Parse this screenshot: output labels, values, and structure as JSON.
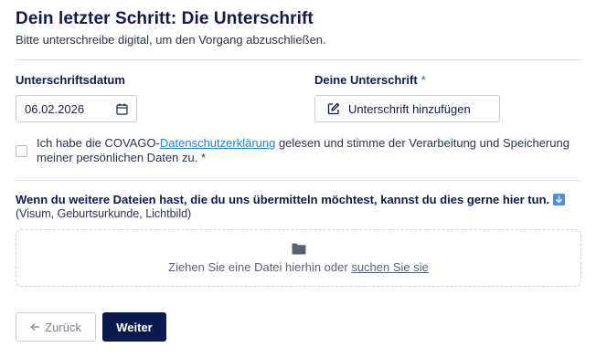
{
  "header": {
    "title": "Dein letzter Schritt: Die Unterschrift",
    "subtitle": "Bitte unterschreibe digital, um den Vorgang abzuschließen."
  },
  "date_field": {
    "label": "Unterschriftsdatum",
    "value": "06.02.2026",
    "icon": "calendar-icon"
  },
  "signature_field": {
    "label": "Deine Unterschrift",
    "required_marker": "*",
    "button_label": "Unterschrift hinzufügen",
    "icon": "edit-icon"
  },
  "consent": {
    "checked": false,
    "text_before": "Ich habe die COVAGO-",
    "link_text": "Datenschutzerklärung",
    "text_after": " gelesen und stimme der Verarbeitung und Speicherung meiner persönlichen Daten zu.",
    "required_marker": " *"
  },
  "upload": {
    "heading": "Wenn du weitere Dateien hast, die du uns übermitteln möchtest, kannst du dies gerne hier tun.",
    "hint": "(Visum, Geburtsurkunde, Lichtbild)",
    "dropzone_text": "Ziehen Sie eine Datei hierhin oder ",
    "dropzone_link": "suchen Sie sie",
    "icon": "folder-icon"
  },
  "footer": {
    "back_label": "Zurück",
    "next_label": "Weiter"
  },
  "colors": {
    "primary": "#0d1a4f",
    "link": "#1f7fd1",
    "border": "#c9ccd4"
  }
}
